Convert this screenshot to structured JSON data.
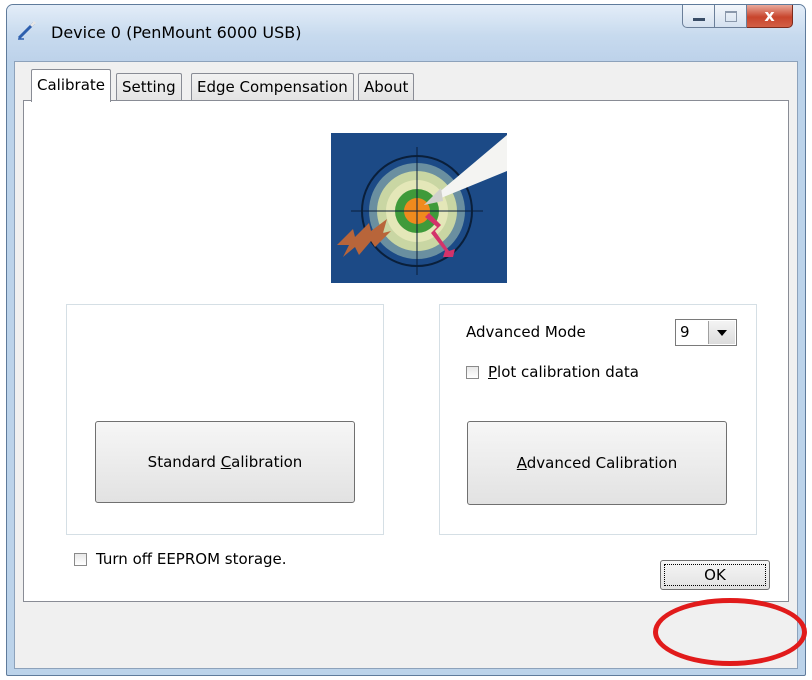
{
  "window": {
    "title": "Device 0 (PenMount 6000 USB)",
    "close_glyph": "x"
  },
  "tabs": [
    {
      "label": "Calibrate",
      "active": true
    },
    {
      "label": "Setting"
    },
    {
      "label": "Edge Compensation"
    },
    {
      "label": "About"
    }
  ],
  "standard": {
    "button_prefix": "Standard ",
    "button_mnemonic": "C",
    "button_suffix": "alibration"
  },
  "advanced": {
    "mode_label": "Advanced Mode",
    "mode_value": "9",
    "plot_mnemonic": "P",
    "plot_suffix": "lot calibration data",
    "plot_checked": false,
    "button_mnemonic": "A",
    "button_suffix": "dvanced Calibration"
  },
  "eeprom": {
    "label": "Turn off EEPROM storage.",
    "checked": false
  },
  "ok": {
    "label": "OK"
  },
  "colors": {
    "highlight_circle": "#e11b1b",
    "logo_background": "#1c4a86"
  }
}
